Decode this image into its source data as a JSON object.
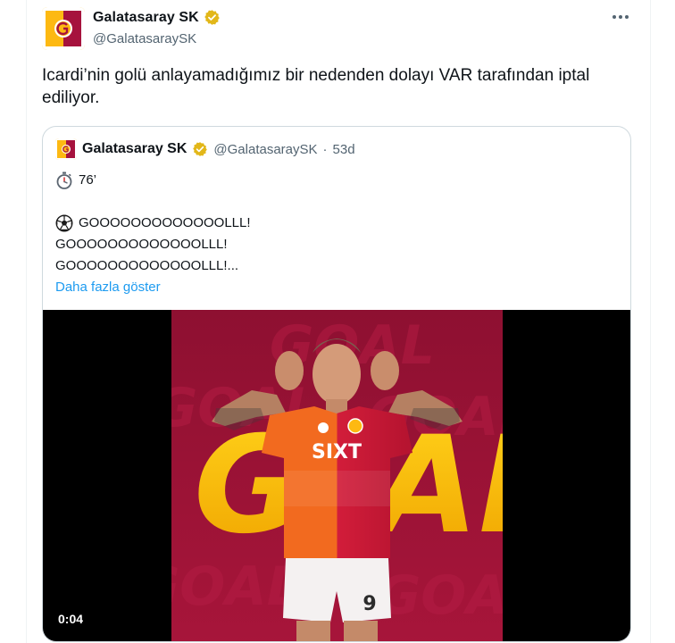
{
  "tweet": {
    "display_name": "Galatasaray SK",
    "handle": "@GalatasaraySK",
    "more_icon": "more-horizontal-icon",
    "text": "Icardi’nin golü anlayamadığımız bir nedenden dolayı VAR tarafından iptal ediliyor."
  },
  "quoted": {
    "display_name": "Galatasaray SK",
    "handle": "@GalatasaraySK",
    "separator": "·",
    "time": "53d",
    "minute": "76’",
    "goal_lines": [
      "GOOOOOOOOOOOOOLLL!",
      "GOOOOOOOOOOOOOLLL!",
      "GOOOOOOOOOOOOOLLL!..."
    ],
    "show_more": "Daha fazla göster",
    "video": {
      "duration": "0:04",
      "graphic_text": "GOAL",
      "sponsor": "SIXT",
      "shirt_number": "9"
    }
  },
  "colors": {
    "verified": "#e2b719",
    "link": "#1d9bf0",
    "club_red": "#a6123d",
    "club_yellow": "#fdb912"
  }
}
